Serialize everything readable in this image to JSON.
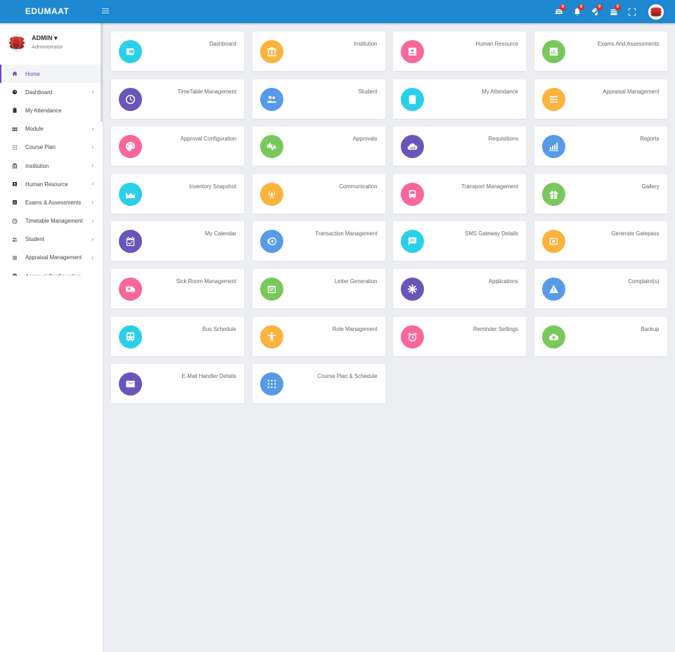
{
  "app": {
    "brand": "EDUMAAT"
  },
  "topbar": {
    "icons": [
      {
        "name": "messages-icon",
        "badge": "0"
      },
      {
        "name": "bell-icon",
        "badge": "0"
      },
      {
        "name": "tags-icon",
        "badge": "0"
      },
      {
        "name": "inbox-icon",
        "badge": "0"
      },
      {
        "name": "fullscreen-icon",
        "badge": ""
      }
    ]
  },
  "user": {
    "name": "ADMIN ▾",
    "role": "Administrator"
  },
  "sidebar": {
    "items": [
      {
        "label": "Home",
        "icon": "home-icon",
        "active": true,
        "chevron": ""
      },
      {
        "label": "Dashboard",
        "icon": "dashboard-icon",
        "chevron": "›"
      },
      {
        "label": "My Attendance",
        "icon": "clipboard-icon",
        "chevron": ""
      },
      {
        "label": "Module",
        "icon": "grid-icon",
        "chevron": "›"
      },
      {
        "label": "Course Plan",
        "icon": "dots-grid-icon",
        "chevron": "›"
      },
      {
        "label": "Institution",
        "icon": "bank-icon",
        "chevron": "›"
      },
      {
        "label": "Human Resource",
        "icon": "id-card-icon",
        "chevron": "›"
      },
      {
        "label": "Exams & Assessments",
        "icon": "chart-icon",
        "chevron": "›"
      },
      {
        "label": "Timetable Management",
        "icon": "clock-icon",
        "chevron": "›"
      },
      {
        "label": "Student",
        "icon": "people-icon",
        "chevron": "›"
      },
      {
        "label": "Appraisal Management",
        "icon": "list-icon",
        "chevron": "›"
      },
      {
        "label": "Approval Configuration",
        "icon": "palette-icon",
        "chevron": ""
      }
    ]
  },
  "cards": [
    {
      "label": "Dashboard",
      "color": "#29d0e8",
      "icon": "wallet-icon"
    },
    {
      "label": "Institution",
      "color": "#fbb33d",
      "icon": "bank-icon"
    },
    {
      "label": "Human Resource",
      "color": "#f8679b",
      "icon": "id-card-icon"
    },
    {
      "label": "Exams And Assessments",
      "color": "#79c85c",
      "icon": "chart-icon"
    },
    {
      "label": "TimeTable Management",
      "color": "#6a55b8",
      "icon": "clock-icon"
    },
    {
      "label": "Student",
      "color": "#579ae8",
      "icon": "people-icon"
    },
    {
      "label": "My Attendance",
      "color": "#29d0e8",
      "icon": "clipboard-icon"
    },
    {
      "label": "Appraisal Management",
      "color": "#fbb33d",
      "icon": "list-icon"
    },
    {
      "label": "Approval Configuration",
      "color": "#f8679b",
      "icon": "palette-icon"
    },
    {
      "label": "Approvals",
      "color": "#79c85c",
      "icon": "thumbs-icon"
    },
    {
      "label": "Requisitions",
      "color": "#6a55b8",
      "icon": "cloud-chart-icon"
    },
    {
      "label": "Reports",
      "color": "#579ae8",
      "icon": "bar-chart-icon"
    },
    {
      "label": "Inventory Snapshot",
      "color": "#29d0e8",
      "icon": "area-chart-icon"
    },
    {
      "label": "Communication",
      "color": "#fbb33d",
      "icon": "antenna-icon"
    },
    {
      "label": "Transport Management",
      "color": "#f8679b",
      "icon": "bus-icon"
    },
    {
      "label": "Gallery",
      "color": "#79c85c",
      "icon": "gift-icon"
    },
    {
      "label": "My Calendar",
      "color": "#6a55b8",
      "icon": "calendar-check-icon"
    },
    {
      "label": "Transaction Management",
      "color": "#579ae8",
      "icon": "add-circle-icon"
    },
    {
      "label": "SMS Gateway Details",
      "color": "#29d0e8",
      "icon": "message-icon"
    },
    {
      "label": "Generate Gatepass",
      "color": "#fbb33d",
      "icon": "gatepass-icon"
    },
    {
      "label": "Sick Room Management",
      "color": "#f8679b",
      "icon": "ambulance-icon"
    },
    {
      "label": "Letter Generation",
      "color": "#79c85c",
      "icon": "letter-icon"
    },
    {
      "label": "Applications",
      "color": "#6a55b8",
      "icon": "asterisk-icon"
    },
    {
      "label": "Complaint(s)",
      "color": "#579ae8",
      "icon": "warning-icon"
    },
    {
      "label": "Bus Schedule",
      "color": "#29d0e8",
      "icon": "train-icon"
    },
    {
      "label": "Role Management",
      "color": "#fbb33d",
      "icon": "accessibility-icon"
    },
    {
      "label": "Reminder Settings",
      "color": "#f8679b",
      "icon": "alarm-icon"
    },
    {
      "label": "Backup",
      "color": "#79c85c",
      "icon": "cloud-upload-icon"
    },
    {
      "label": "E-Mail Handler Details",
      "color": "#6a55b8",
      "icon": "mail-icon"
    },
    {
      "label": "Course Plan & Schedule",
      "color": "#579ae8",
      "icon": "dots-grid-icon"
    }
  ]
}
